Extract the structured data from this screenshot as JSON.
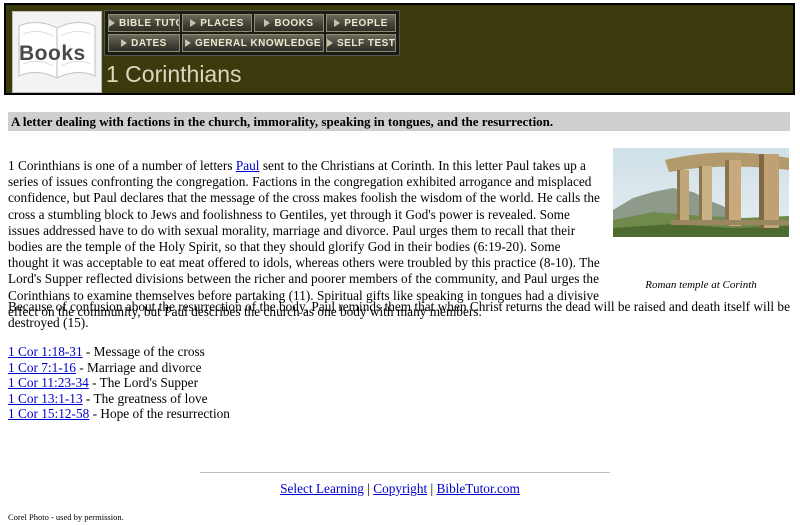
{
  "header": {
    "logo_text": "Books",
    "page_title": "1 Corinthians",
    "nav": [
      "BIBLE TUTOR",
      "PLACES",
      "BOOKS",
      "PEOPLE",
      "DATES",
      "GENERAL KNOWLEDGE",
      "SELF TESTS"
    ]
  },
  "summary": "A letter dealing with factions in the church, immorality, speaking in tongues, and the resurrection.",
  "intro": {
    "before_link": "1 Corinthians is one of a number of letters ",
    "link": "Paul",
    "after_link": " sent to the Christians at Corinth. In this letter Paul takes up a series of issues confronting the congregation. Factions in the congregation exhibited arrogance and misplaced confidence, but Paul declares that the message of the cross makes foolish the wisdom of the world. He calls the cross a stumbling block to Jews and foolishness to Gentiles, yet through it God's power is revealed. Some issues addressed have to do with sexual morality, marriage and divorce. Paul urges them to recall that their bodies are the temple of the Holy Spirit, so that they should glorify God in their bodies (6:19-20). Some thought it was acceptable to eat meat offered to idols, whereas others were troubled by this practice (8-10). The Lord's Supper reflected divisions between the richer and poorer members of the community, and Paul urges the Corinthians to examine themselves before partaking (11). Spiritual gifts like speaking in tongues had a divisive effect on the community, but Paul describes the church as one body with many members.",
    "continuation": "Because of confusion about the resurrection of the body, Paul reminds them that when Christ returns the dead will be raised and death itself will be destroyed (15)."
  },
  "photo": {
    "caption": "Roman temple at Corinth"
  },
  "passages": [
    {
      "ref": "1 Cor 1:18-31",
      "desc": " - Message of the cross"
    },
    {
      "ref": "1 Cor 7:1-16",
      "desc": " - Marriage and divorce"
    },
    {
      "ref": "1 Cor 11:23-34",
      "desc": " - The Lord's Supper"
    },
    {
      "ref": "1 Cor 13:1-13",
      "desc": " - The greatness of love"
    },
    {
      "ref": "1 Cor 15:12-58",
      "desc": " - Hope of the resurrection"
    }
  ],
  "footer": {
    "links": [
      "Select Learning",
      "Copyright",
      "BibleTutor.com"
    ],
    "separator": " | ",
    "credit": "Corel Photo - used by permission."
  }
}
